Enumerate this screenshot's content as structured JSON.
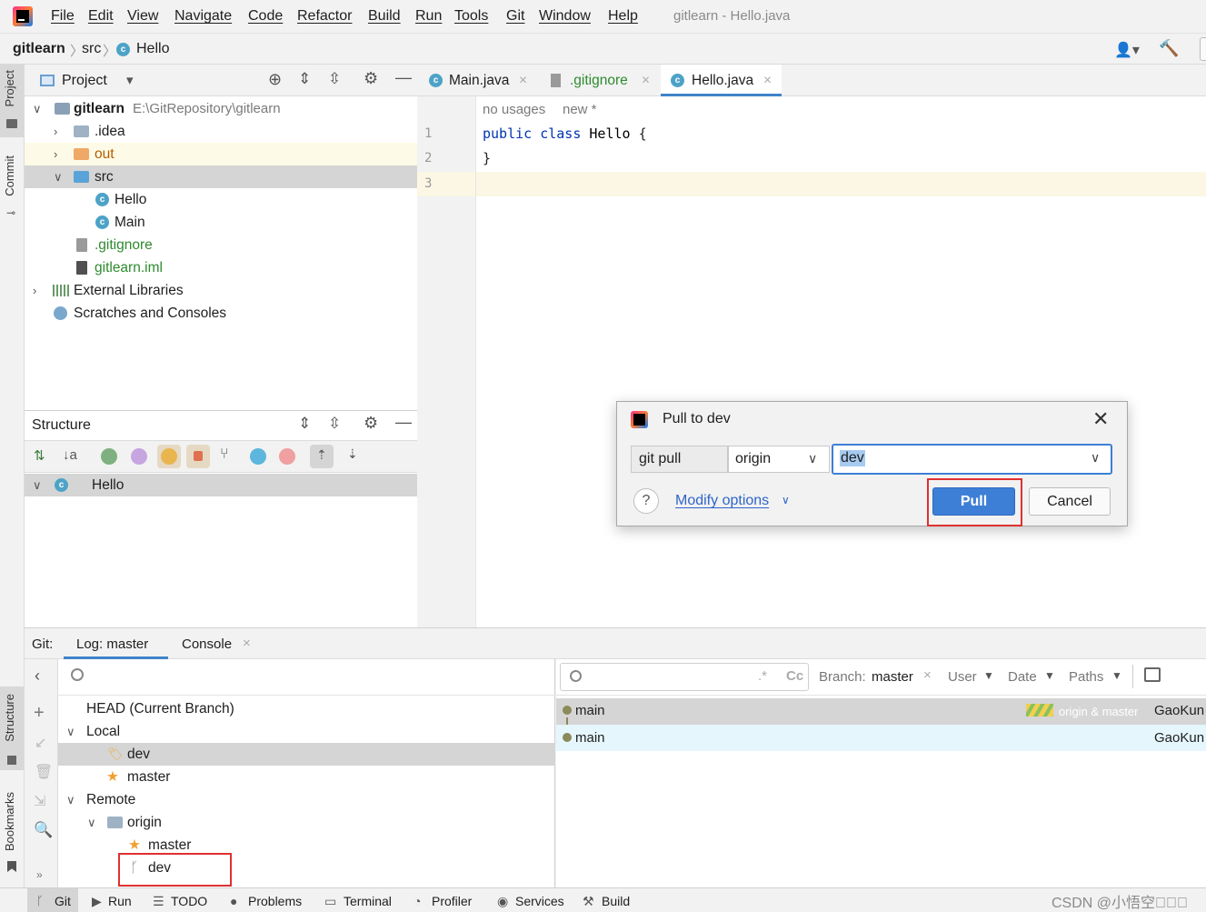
{
  "menu": {
    "items": [
      "File",
      "Edit",
      "View",
      "Navigate",
      "Code",
      "Refactor",
      "Build",
      "Run",
      "Tools",
      "Git",
      "Window",
      "Help"
    ],
    "window_title": "gitlearn - Hello.java"
  },
  "nav": {
    "project": "gitlearn",
    "folder": "src",
    "file": "Hello"
  },
  "side_tabs": {
    "project": "Project",
    "commit": "Commit",
    "structure": "Structure",
    "bookmarks": "Bookmarks"
  },
  "project_panel": {
    "title": "Project",
    "tree": [
      {
        "label": "gitlearn",
        "path": "E:\\GitRepository\\gitlearn"
      },
      {
        "label": ".idea"
      },
      {
        "label": "out"
      },
      {
        "label": "src"
      },
      {
        "label": "Hello"
      },
      {
        "label": "Main"
      },
      {
        "label": ".gitignore"
      },
      {
        "label": "gitlearn.iml"
      },
      {
        "label": "External Libraries"
      },
      {
        "label": "Scratches and Consoles"
      }
    ]
  },
  "structure_panel": {
    "title": "Structure",
    "root": "Hello"
  },
  "editor": {
    "tabs": [
      {
        "label": "Main.java"
      },
      {
        "label": ".gitignore"
      },
      {
        "label": "Hello.java"
      }
    ],
    "hint_usages": "no usages",
    "hint_new": "new *",
    "line_numbers": [
      "1",
      "2",
      "3"
    ],
    "code": {
      "kw1": "public",
      "kw2": "class",
      "name": "Hello",
      "brace_open": "{",
      "brace_close": "}"
    }
  },
  "git": {
    "label": "Git:",
    "tabs": [
      "Log: master",
      "Console"
    ],
    "branches": {
      "head": "HEAD (Current Branch)",
      "local": "Local",
      "local_items": [
        "dev",
        "master"
      ],
      "remote": "Remote",
      "origin": "origin",
      "remote_items": [
        "master",
        "dev"
      ]
    },
    "log_toolbar": {
      "branch_label": "Branch:",
      "branch_value": "master",
      "user": "User",
      "date": "Date",
      "paths": "Paths",
      "case_icon": "Cc"
    },
    "commits": [
      {
        "message": "main",
        "refs": "origin & master",
        "author": "GaoKun"
      },
      {
        "message": "main",
        "refs": "",
        "author": "GaoKun"
      }
    ]
  },
  "dialog": {
    "title": "Pull to dev",
    "cmd": "git pull",
    "remote": "origin",
    "branch": "dev",
    "modify_options": "Modify options",
    "help": "?",
    "pull": "Pull",
    "cancel": "Cancel"
  },
  "statusbar": {
    "items": [
      "Git",
      "Run",
      "TODO",
      "Problems",
      "Terminal",
      "Profiler",
      "Services",
      "Build"
    ],
    "watermark": "CSDN @小悟空\u0000\u0000\u0000"
  },
  "colors": {
    "accent": "#3d7fd6",
    "highlight_border": "#e03030",
    "selected_row": "#d5d5d5",
    "log_selected": "#e5f6fd"
  }
}
